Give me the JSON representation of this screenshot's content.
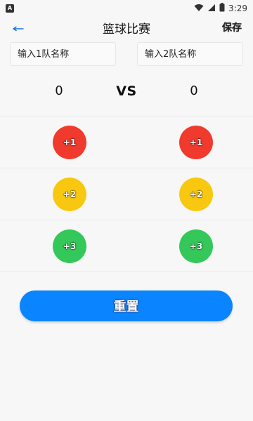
{
  "status_bar": {
    "app_badge": "A",
    "time": "3:29"
  },
  "app_bar": {
    "title": "篮球比赛",
    "save_label": "保存"
  },
  "teams": {
    "team1_placeholder": "输入1队名称",
    "team2_placeholder": "输入2队名称"
  },
  "scoreboard": {
    "team1_score": "0",
    "vs_label": "VS",
    "team2_score": "0"
  },
  "buttons": {
    "plus1": "+1",
    "plus2": "+2",
    "plus3": "+3"
  },
  "reset_label": "重置",
  "colors": {
    "plus1": "#f03a2e",
    "plus2": "#f8c811",
    "plus3": "#34c759",
    "reset": "#0a84ff"
  },
  "icons": {
    "back": "back-arrow-icon",
    "wifi": "wifi-icon",
    "signal": "signal-icon",
    "battery": "battery-icon"
  }
}
